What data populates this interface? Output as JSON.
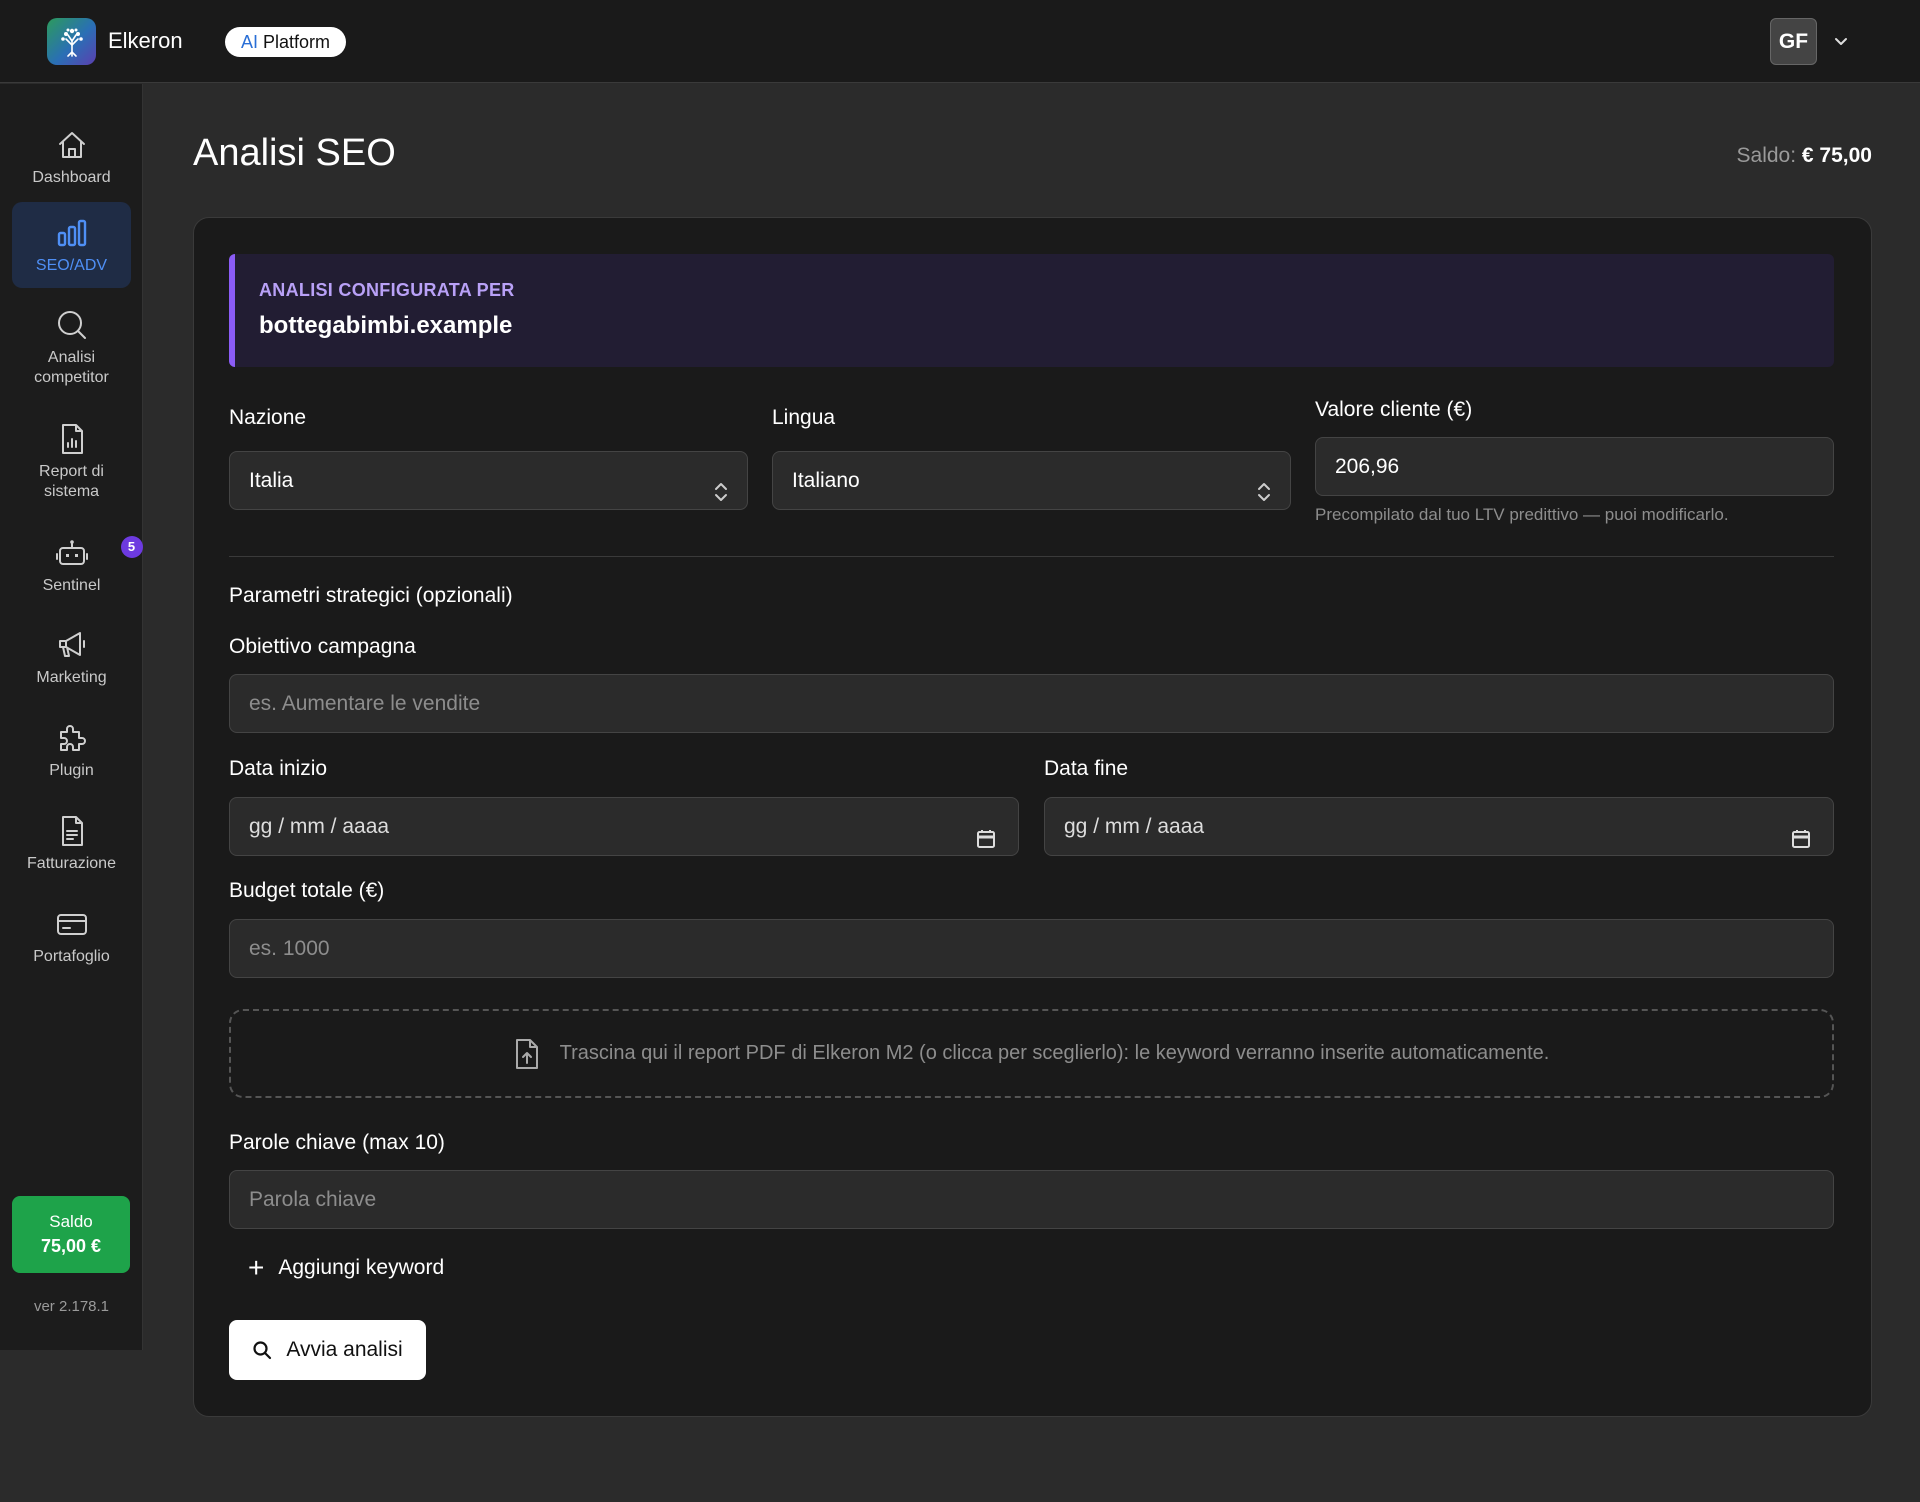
{
  "brand": {
    "name": "Elkeron",
    "badge_ai": "AI",
    "badge_rest": "Platform"
  },
  "user": {
    "initials": "GF"
  },
  "sidebar": {
    "items": [
      {
        "label": "Dashboard",
        "icon": "home-icon"
      },
      {
        "label": "SEO/ADV",
        "icon": "bar-chart-icon",
        "active": true
      },
      {
        "label": "Analisi competitor",
        "icon": "search-icon"
      },
      {
        "label": "Report di sistema",
        "icon": "report-icon"
      },
      {
        "label": "Sentinel",
        "icon": "robot-icon",
        "badge": "5"
      },
      {
        "label": "Marketing",
        "icon": "megaphone-icon"
      },
      {
        "label": "Plugin",
        "icon": "puzzle-icon"
      },
      {
        "label": "Fatturazione",
        "icon": "invoice-icon"
      },
      {
        "label": "Portafoglio",
        "icon": "wallet-icon"
      }
    ],
    "saldo_label": "Saldo",
    "saldo_amount": "75,00 €",
    "version": "ver 2.178.1"
  },
  "header": {
    "title": "Analisi SEO",
    "balance_label": "Saldo:",
    "balance_value": "€ 75,00"
  },
  "notice": {
    "label": "ANALISI CONFIGURATA PER",
    "value": "bottegabimbi.example"
  },
  "form": {
    "nazione": {
      "label": "Nazione",
      "value": "Italia"
    },
    "lingua": {
      "label": "Lingua",
      "value": "Italiano"
    },
    "valore_cliente": {
      "label": "Valore cliente (€)",
      "value": "206,96",
      "hint": "Precompilato dal tuo LTV predittivo — puoi modificarlo."
    },
    "section_title": "Parametri strategici (opzionali)",
    "obiettivo": {
      "label": "Obiettivo campagna",
      "placeholder": "es. Aumentare le vendite"
    },
    "data_inizio": {
      "label": "Data inizio",
      "placeholder": "gg / mm / aaaa"
    },
    "data_fine": {
      "label": "Data fine",
      "placeholder": "gg / mm / aaaa"
    },
    "budget": {
      "label": "Budget totale (€)",
      "placeholder": "es. 1000"
    },
    "dropzone_text": "Trascina qui il report PDF di Elkeron M2 (o clicca per sceglierlo): le keyword verranno inserite automaticamente.",
    "keywords": {
      "label": "Parole chiave (max 10)",
      "placeholder": "Parola chiave"
    },
    "add_keyword_label": "Aggiungi keyword",
    "submit_label": "Avvia analisi"
  }
}
